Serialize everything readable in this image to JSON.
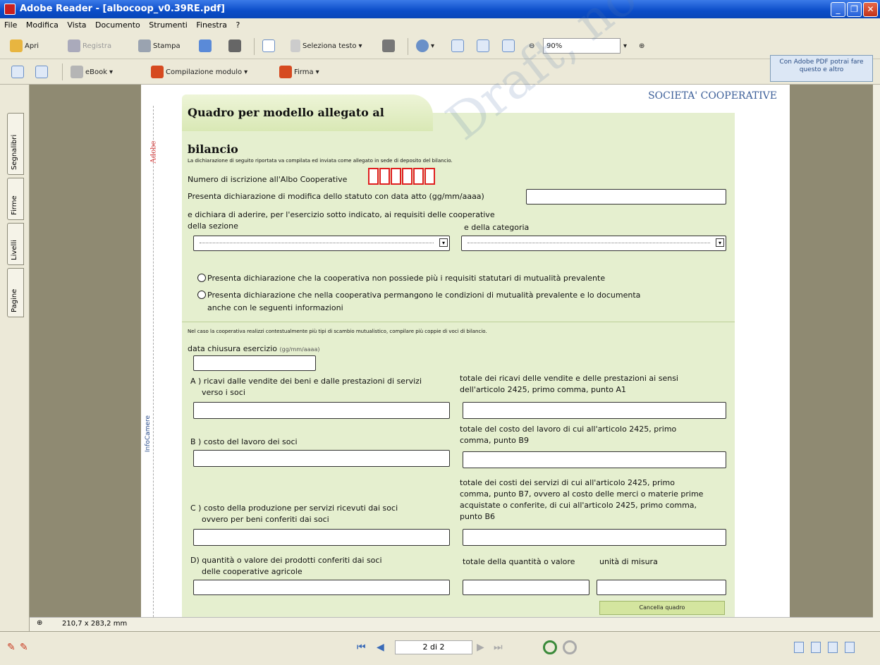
{
  "window": {
    "title": "Adobe Reader - [albocoop_v0.39RE.pdf]"
  },
  "menu": [
    "File",
    "Modifica",
    "Vista",
    "Documento",
    "Strumenti",
    "Finestra",
    "?"
  ],
  "toolbar1": {
    "open": "Apri",
    "save": "Registra",
    "print": "Stampa",
    "select_text": "Seleziona testo",
    "zoom": "90%"
  },
  "toolbar2": {
    "ebook": "eBook",
    "form_fill": "Compilazione modulo",
    "sign": "Firma"
  },
  "promo": {
    "text": "Con Adobe PDF potrai fare questo e altro"
  },
  "side_tabs": [
    "Segnalibri",
    "Firme",
    "Livelli",
    "Pagine"
  ],
  "status": {
    "page_size": "210,7 x 283,2 mm",
    "page_indicator": "2 di 2"
  },
  "pdf": {
    "corner_label": "SOCIETA' COOPERATIVE",
    "strip_label": "Adobe",
    "strip_label2": "InfoCamere",
    "form_title": "Quadro per modello allegato al bilancio",
    "intro": "La dichiarazione di seguito riportata va compilata ed inviata come allegato in sede di deposito del bilancio.",
    "reg_number_label": "Numero di iscrizione all'Albo Cooperative",
    "amend_label": "Presenta dichiarazione di modifica dello statuto con data atto",
    "amend_hint": "(gg/mm/aaaa)",
    "declare_label": "e dichiara di aderire, per l'esercizio sotto indicato, ai requisiti delle cooperative",
    "section_label": "della sezione",
    "category_label": "e della categoria",
    "radio1": "Presenta dichiarazione che la cooperativa non possiede più i requisiti statutari di mutualità prevalente",
    "radio2a": "Presenta dichiarazione che nella cooperativa permangono le condizioni di mutualità prevalente e lo documenta",
    "radio2b": "anche con le seguenti informazioni",
    "note": "Nel caso la cooperativa realizzi contestualmente più tipi di scambio mutualistico, compilare più coppie di voci di bilancio.",
    "close_date_label": "data chiusura esercizio",
    "close_date_hint": "(gg/mm/aaaa)",
    "a_left1": "A ) ricavi dalle vendite dei beni e dalle prestazioni di servizi",
    "a_left2": "verso i soci",
    "a_right1": "totale dei ricavi delle vendite e delle prestazioni ai sensi",
    "a_right2": "dell'articolo 2425, primo comma, punto A1",
    "b_left": "B ) costo del lavoro dei soci",
    "b_right1": "totale del costo del lavoro di cui all'articolo 2425, primo",
    "b_right2": "comma, punto B9",
    "c_left1": "C ) costo della produzione per servizi ricevuti dai soci",
    "c_left2": "ovvero per beni conferiti dai soci",
    "c_right1": "totale dei costi dei servizi di cui all'articolo 2425, primo",
    "c_right2": "comma, punto B7, ovvero al costo delle merci o materie prime",
    "c_right3": "acquistate o conferite, di cui all'articolo 2425, primo comma,",
    "c_right4": "punto B6",
    "d_left1": "D) quantità o valore dei prodotti conferiti dai soci",
    "d_left2": "delle cooperative agricole",
    "d_right1": "totale della quantità o valore",
    "d_right2": "unità di misura",
    "cancel_button": "Cancella quadro",
    "watermark": "Draft, not for production use"
  },
  "colors": {
    "titlebar": "#0a4cc8",
    "form_bg": "#e5efcf",
    "reg_box": "#e02020"
  }
}
